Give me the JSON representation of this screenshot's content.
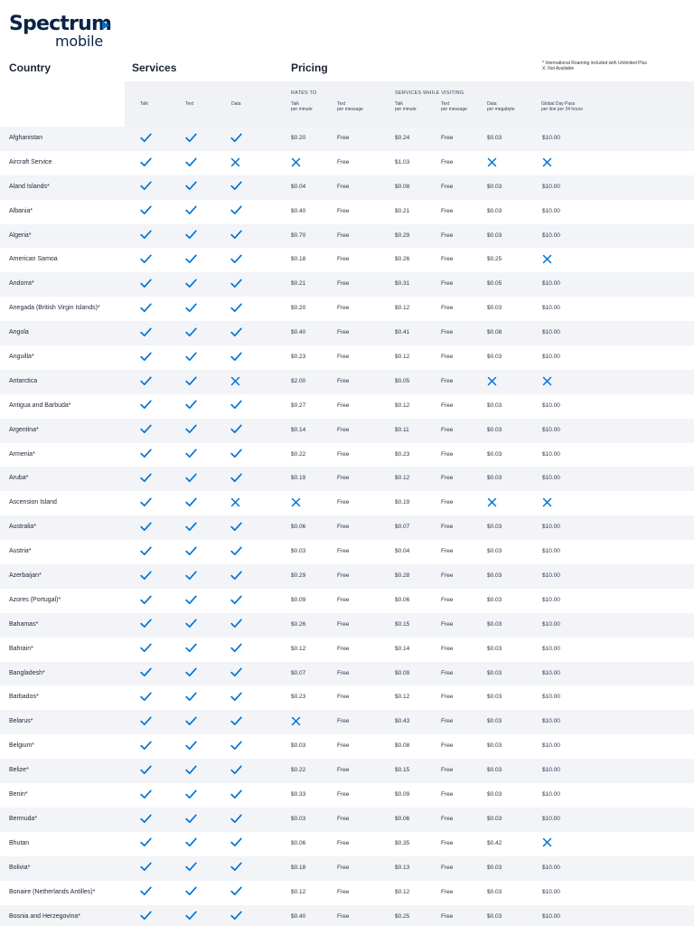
{
  "logo": {
    "word": "Spectrum",
    "sub": "mobile"
  },
  "notes": {
    "line1": "* International Roaming included with Unlimited Plus",
    "line2": "X: Not Available"
  },
  "headings": {
    "country": "Country",
    "services": "Services",
    "pricing": "Pricing"
  },
  "subheader": {
    "talk": "Talk",
    "text": "Text",
    "data": "Data",
    "rates_to": "RATES TO",
    "services_while_visiting": "SERVICES WHILE VISITING",
    "rt_talk": "Talk",
    "rt_talk_unit": "per minute",
    "rt_text": "Text",
    "rt_text_unit": "per message",
    "sv_talk": "Talk",
    "sv_talk_unit": "per minute",
    "sv_text": "Text",
    "sv_text_unit": "per message",
    "sv_data": "Data",
    "sv_data_unit": "per megabyte",
    "gdp": "Global Day Pass",
    "gdp_unit": "per line per 24 hours"
  },
  "marks": {
    "yes": "checkmark-icon",
    "no": "x-icon",
    "check_color": "#0073d1",
    "x_color": "#0073d1"
  },
  "rows": [
    {
      "country": "Afghanistan",
      "talk": true,
      "text": true,
      "data": true,
      "rates_talk": "$0.20",
      "rates_text": "Free",
      "visit_talk": "$0.24",
      "visit_text": "Free",
      "visit_data": "$0.03",
      "day_pass": "$10.00"
    },
    {
      "country": "Aircraft Service",
      "talk": true,
      "text": true,
      "data": false,
      "rates_talk": null,
      "rates_text": "Free",
      "visit_talk": "$1.03",
      "visit_text": "Free",
      "visit_data": null,
      "day_pass": null
    },
    {
      "country": "Aland Islands*",
      "talk": true,
      "text": true,
      "data": true,
      "rates_talk": "$0.04",
      "rates_text": "Free",
      "visit_talk": "$0.08",
      "visit_text": "Free",
      "visit_data": "$0.03",
      "day_pass": "$10.00"
    },
    {
      "country": "Albania*",
      "talk": true,
      "text": true,
      "data": true,
      "rates_talk": "$0.40",
      "rates_text": "Free",
      "visit_talk": "$0.21",
      "visit_text": "Free",
      "visit_data": "$0.03",
      "day_pass": "$10.00"
    },
    {
      "country": "Algeria*",
      "talk": true,
      "text": true,
      "data": true,
      "rates_talk": "$0.70",
      "rates_text": "Free",
      "visit_talk": "$0.29",
      "visit_text": "Free",
      "visit_data": "$0.03",
      "day_pass": "$10.00"
    },
    {
      "country": "American Samoa",
      "talk": true,
      "text": true,
      "data": true,
      "rates_talk": "$0.18",
      "rates_text": "Free",
      "visit_talk": "$0.26",
      "visit_text": "Free",
      "visit_data": "$0.25",
      "day_pass": null
    },
    {
      "country": "Andorra*",
      "talk": true,
      "text": true,
      "data": true,
      "rates_talk": "$0.21",
      "rates_text": "Free",
      "visit_talk": "$0.31",
      "visit_text": "Free",
      "visit_data": "$0.05",
      "day_pass": "$10.00"
    },
    {
      "country": "Anegada (British Virgin Islands)*",
      "talk": true,
      "text": true,
      "data": true,
      "rates_talk": "$0.20",
      "rates_text": "Free",
      "visit_talk": "$0.12",
      "visit_text": "Free",
      "visit_data": "$0.03",
      "day_pass": "$10.00"
    },
    {
      "country": "Angola",
      "talk": true,
      "text": true,
      "data": true,
      "rates_talk": "$0.40",
      "rates_text": "Free",
      "visit_talk": "$0.41",
      "visit_text": "Free",
      "visit_data": "$0.08",
      "day_pass": "$10.00"
    },
    {
      "country": "Anguilla*",
      "talk": true,
      "text": true,
      "data": true,
      "rates_talk": "$0.23",
      "rates_text": "Free",
      "visit_talk": "$0.12",
      "visit_text": "Free",
      "visit_data": "$0.03",
      "day_pass": "$10.00"
    },
    {
      "country": "Antarctica",
      "talk": true,
      "text": true,
      "data": false,
      "rates_talk": "$2.00",
      "rates_text": "Free",
      "visit_talk": "$0.05",
      "visit_text": "Free",
      "visit_data": null,
      "day_pass": null
    },
    {
      "country": "Antigua and Barbuda*",
      "talk": true,
      "text": true,
      "data": true,
      "rates_talk": "$0.27",
      "rates_text": "Free",
      "visit_talk": "$0.12",
      "visit_text": "Free",
      "visit_data": "$0.03",
      "day_pass": "$10.00"
    },
    {
      "country": "Argentina*",
      "talk": true,
      "text": true,
      "data": true,
      "rates_talk": "$0.14",
      "rates_text": "Free",
      "visit_talk": "$0.11",
      "visit_text": "Free",
      "visit_data": "$0.03",
      "day_pass": "$10.00"
    },
    {
      "country": "Armenia*",
      "talk": true,
      "text": true,
      "data": true,
      "rates_talk": "$0.22",
      "rates_text": "Free",
      "visit_talk": "$0.23",
      "visit_text": "Free",
      "visit_data": "$0.03",
      "day_pass": "$10.00"
    },
    {
      "country": "Aruba*",
      "talk": true,
      "text": true,
      "data": true,
      "rates_talk": "$0.19",
      "rates_text": "Free",
      "visit_talk": "$0.12",
      "visit_text": "Free",
      "visit_data": "$0.03",
      "day_pass": "$10.00"
    },
    {
      "country": "Ascension Island",
      "talk": true,
      "text": true,
      "data": false,
      "rates_talk": null,
      "rates_text": "Free",
      "visit_talk": "$0.19",
      "visit_text": "Free",
      "visit_data": null,
      "day_pass": null
    },
    {
      "country": "Australia*",
      "talk": true,
      "text": true,
      "data": true,
      "rates_talk": "$0.06",
      "rates_text": "Free",
      "visit_talk": "$0.07",
      "visit_text": "Free",
      "visit_data": "$0.03",
      "day_pass": "$10.00"
    },
    {
      "country": "Austria*",
      "talk": true,
      "text": true,
      "data": true,
      "rates_talk": "$0.03",
      "rates_text": "Free",
      "visit_talk": "$0.04",
      "visit_text": "Free",
      "visit_data": "$0.03",
      "day_pass": "$10.00"
    },
    {
      "country": "Azerbaijan*",
      "talk": true,
      "text": true,
      "data": true,
      "rates_talk": "$0.29",
      "rates_text": "Free",
      "visit_talk": "$0.28",
      "visit_text": "Free",
      "visit_data": "$0.03",
      "day_pass": "$10.00"
    },
    {
      "country": "Azores (Portugal)*",
      "talk": true,
      "text": true,
      "data": true,
      "rates_talk": "$0.09",
      "rates_text": "Free",
      "visit_talk": "$0.06",
      "visit_text": "Free",
      "visit_data": "$0.03",
      "day_pass": "$10.00"
    },
    {
      "country": "Bahamas*",
      "talk": true,
      "text": true,
      "data": true,
      "rates_talk": "$0.26",
      "rates_text": "Free",
      "visit_talk": "$0.15",
      "visit_text": "Free",
      "visit_data": "$0.03",
      "day_pass": "$10.00"
    },
    {
      "country": "Bahrain*",
      "talk": true,
      "text": true,
      "data": true,
      "rates_talk": "$0.12",
      "rates_text": "Free",
      "visit_talk": "$0.14",
      "visit_text": "Free",
      "visit_data": "$0.03",
      "day_pass": "$10.00"
    },
    {
      "country": "Bangladesh*",
      "talk": true,
      "text": true,
      "data": true,
      "rates_talk": "$0.07",
      "rates_text": "Free",
      "visit_talk": "$0.09",
      "visit_text": "Free",
      "visit_data": "$0.03",
      "day_pass": "$10.00"
    },
    {
      "country": "Barbados*",
      "talk": true,
      "text": true,
      "data": true,
      "rates_talk": "$0.23",
      "rates_text": "Free",
      "visit_talk": "$0.12",
      "visit_text": "Free",
      "visit_data": "$0.03",
      "day_pass": "$10.00"
    },
    {
      "country": "Belarus*",
      "talk": true,
      "text": true,
      "data": true,
      "rates_talk": null,
      "rates_text": "Free",
      "visit_talk": "$0.43",
      "visit_text": "Free",
      "visit_data": "$0.03",
      "day_pass": "$10.00"
    },
    {
      "country": "Belgium*",
      "talk": true,
      "text": true,
      "data": true,
      "rates_talk": "$0.03",
      "rates_text": "Free",
      "visit_talk": "$0.08",
      "visit_text": "Free",
      "visit_data": "$0.03",
      "day_pass": "$10.00"
    },
    {
      "country": "Belize*",
      "talk": true,
      "text": true,
      "data": true,
      "rates_talk": "$0.22",
      "rates_text": "Free",
      "visit_talk": "$0.15",
      "visit_text": "Free",
      "visit_data": "$0.03",
      "day_pass": "$10.00"
    },
    {
      "country": "Benin*",
      "talk": true,
      "text": true,
      "data": true,
      "rates_talk": "$0.33",
      "rates_text": "Free",
      "visit_talk": "$0.09",
      "visit_text": "Free",
      "visit_data": "$0.03",
      "day_pass": "$10.00"
    },
    {
      "country": "Bermuda*",
      "talk": true,
      "text": true,
      "data": true,
      "rates_talk": "$0.03",
      "rates_text": "Free",
      "visit_talk": "$0.06",
      "visit_text": "Free",
      "visit_data": "$0.03",
      "day_pass": "$10.00"
    },
    {
      "country": "Bhutan",
      "talk": true,
      "text": true,
      "data": true,
      "rates_talk": "$0.06",
      "rates_text": "Free",
      "visit_talk": "$0.35",
      "visit_text": "Free",
      "visit_data": "$0.42",
      "day_pass": null
    },
    {
      "country": "Bolivia*",
      "talk": true,
      "text": true,
      "data": true,
      "rates_talk": "$0.18",
      "rates_text": "Free",
      "visit_talk": "$0.13",
      "visit_text": "Free",
      "visit_data": "$0.03",
      "day_pass": "$10.00"
    },
    {
      "country": "Bonaire (Netherlands Antilles)*",
      "talk": true,
      "text": true,
      "data": true,
      "rates_talk": "$0.12",
      "rates_text": "Free",
      "visit_talk": "$0.12",
      "visit_text": "Free",
      "visit_data": "$0.03",
      "day_pass": "$10.00"
    },
    {
      "country": "Bosnia and Herzegovina*",
      "talk": true,
      "text": true,
      "data": true,
      "rates_talk": "$0.40",
      "rates_text": "Free",
      "visit_talk": "$0.25",
      "visit_text": "Free",
      "visit_data": "$0.03",
      "day_pass": "$10.00"
    }
  ]
}
